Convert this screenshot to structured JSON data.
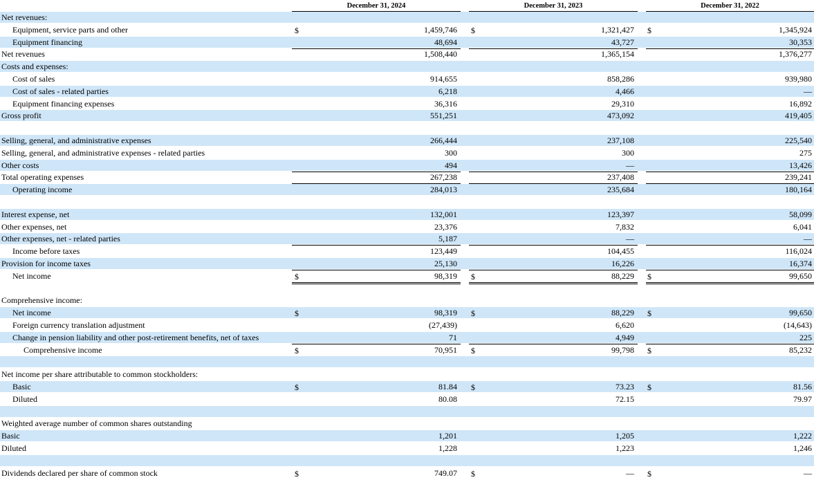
{
  "headers": [
    "December 31, 2024",
    "December 31, 2023",
    "December 31, 2022"
  ],
  "rows": [
    {
      "label": "Net revenues:",
      "indent": 0,
      "band": true
    },
    {
      "label": "Equipment, service parts and other",
      "indent": 1,
      "band": false,
      "dollar": [
        true,
        true,
        true
      ],
      "values": [
        "1,459,746",
        "1,321,427",
        "1,345,924"
      ]
    },
    {
      "label": "Equipment financing",
      "indent": 1,
      "band": true,
      "values": [
        "48,694",
        "43,727",
        "30,353"
      ],
      "rule": "single"
    },
    {
      "label": "Net revenues",
      "indent": 0,
      "band": false,
      "values": [
        "1,508,440",
        "1,365,154",
        "1,376,277"
      ]
    },
    {
      "label": "Costs and expenses:",
      "indent": 0,
      "band": true
    },
    {
      "label": "Cost of sales",
      "indent": 1,
      "band": false,
      "values": [
        "914,655",
        "858,286",
        "939,980"
      ]
    },
    {
      "label": "Cost of sales - related parties",
      "indent": 1,
      "band": true,
      "values": [
        "6,218",
        "4,466",
        "—"
      ]
    },
    {
      "label": "Equipment financing expenses",
      "indent": 1,
      "band": false,
      "values": [
        "36,316",
        "29,310",
        "16,892"
      ],
      "rule": "single"
    },
    {
      "label": "Gross profit",
      "indent": 0,
      "band": true,
      "values": [
        "551,251",
        "473,092",
        "419,405"
      ]
    },
    {
      "label": "",
      "indent": 0,
      "band": false
    },
    {
      "label": "Selling, general, and administrative expenses",
      "indent": 0,
      "band": true,
      "values": [
        "266,444",
        "237,108",
        "225,540"
      ]
    },
    {
      "label": "Selling, general, and administrative expenses - related parties",
      "indent": 0,
      "band": false,
      "values": [
        "300",
        "300",
        "275"
      ]
    },
    {
      "label": "Other costs",
      "indent": 0,
      "band": true,
      "values": [
        "494",
        "—",
        "13,426"
      ],
      "rule": "single"
    },
    {
      "label": "Total operating expenses",
      "indent": 0,
      "band": false,
      "values": [
        "267,238",
        "237,408",
        "239,241"
      ],
      "rule": "single"
    },
    {
      "label": "Operating income",
      "indent": 1,
      "band": true,
      "values": [
        "284,013",
        "235,684",
        "180,164"
      ]
    },
    {
      "label": "",
      "indent": 0,
      "band": false
    },
    {
      "label": "Interest expense, net",
      "indent": 0,
      "band": true,
      "values": [
        "132,001",
        "123,397",
        "58,099"
      ]
    },
    {
      "label": "Other expenses, net",
      "indent": 0,
      "band": false,
      "values": [
        "23,376",
        "7,832",
        "6,041"
      ]
    },
    {
      "label": "Other expenses, net - related parties",
      "indent": 0,
      "band": true,
      "values": [
        "5,187",
        "—",
        "—"
      ],
      "rule": "single"
    },
    {
      "label": "Income before taxes",
      "indent": 1,
      "band": false,
      "values": [
        "123,449",
        "104,455",
        "116,024"
      ]
    },
    {
      "label": "Provision for income taxes",
      "indent": 0,
      "band": true,
      "values": [
        "25,130",
        "16,226",
        "16,374"
      ],
      "rule": "single"
    },
    {
      "label": "Net income",
      "indent": 1,
      "band": false,
      "dollar": [
        true,
        true,
        true
      ],
      "values": [
        "98,319",
        "88,229",
        "99,650"
      ],
      "rule": "double"
    },
    {
      "label": "",
      "indent": 0,
      "band": false
    },
    {
      "label": "Comprehensive income:",
      "indent": 0,
      "band": false
    },
    {
      "label": "Net income",
      "indent": 1,
      "band": true,
      "dollar": [
        true,
        true,
        true
      ],
      "values": [
        "98,319",
        "88,229",
        "99,650"
      ]
    },
    {
      "label": "Foreign currency translation adjustment",
      "indent": 1,
      "band": false,
      "values": [
        "(27,439)",
        "6,620",
        "(14,643)"
      ]
    },
    {
      "label": "Change in pension liability and other post-retirement benefits, net of taxes",
      "indent": 1,
      "band": true,
      "values": [
        "71",
        "4,949",
        "225"
      ],
      "rule": "single"
    },
    {
      "label": "Comprehensive income",
      "indent": 2,
      "band": false,
      "dollar": [
        true,
        true,
        true
      ],
      "values": [
        "70,951",
        "99,798",
        "85,232"
      ],
      "rule": "double"
    },
    {
      "label": "",
      "indent": 0,
      "band": true
    },
    {
      "label": "Net income per share attributable to common stockholders:",
      "indent": 0,
      "band": false
    },
    {
      "label": "Basic",
      "indent": 1,
      "band": true,
      "dollar": [
        true,
        true,
        true
      ],
      "values": [
        "81.84",
        "73.23",
        "81.56"
      ]
    },
    {
      "label": "Diluted",
      "indent": 1,
      "band": false,
      "values": [
        "80.08",
        "72.15",
        "79.97"
      ]
    },
    {
      "label": "",
      "indent": 0,
      "band": true
    },
    {
      "label": "Weighted average number of common shares outstanding",
      "indent": 0,
      "band": false
    },
    {
      "label": "Basic",
      "indent": 0,
      "band": true,
      "values": [
        "1,201",
        "1,205",
        "1,222"
      ]
    },
    {
      "label": "Diluted",
      "indent": 0,
      "band": false,
      "values": [
        "1,228",
        "1,223",
        "1,246"
      ]
    },
    {
      "label": "",
      "indent": 0,
      "band": true
    },
    {
      "label": "Dividends declared per share of common stock",
      "indent": 0,
      "band": false,
      "dollar": [
        true,
        true,
        true
      ],
      "values": [
        "749.07",
        "—",
        "—"
      ]
    }
  ]
}
